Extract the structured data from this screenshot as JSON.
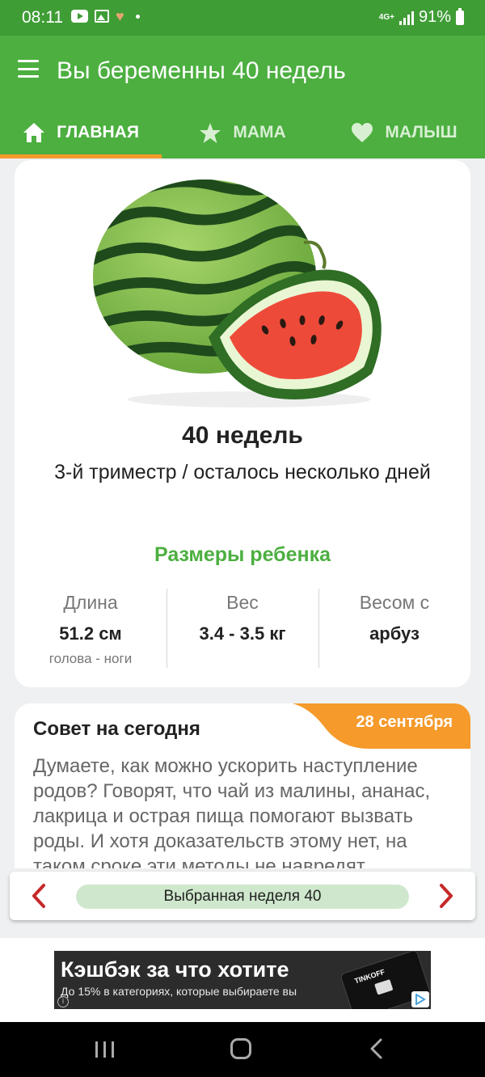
{
  "status_bar": {
    "time": "08:11",
    "network": "4G+",
    "battery": "91%"
  },
  "app_bar": {
    "title": "Вы беременны 40 недель"
  },
  "tabs": [
    {
      "label": "ГЛАВНАЯ",
      "icon": "home-icon",
      "active": true
    },
    {
      "label": "МАМА",
      "icon": "star-icon",
      "active": false
    },
    {
      "label": "МАЛЫШ",
      "icon": "heart-icon",
      "active": false
    }
  ],
  "week_card": {
    "image": "watermelon",
    "weeks_title": "40 недель",
    "trimester": "3-й триместр / осталось несколько дней",
    "sizes_title": "Размеры ребенка",
    "stats": [
      {
        "label": "Длина",
        "value": "51.2 см",
        "sub": "голова - ноги"
      },
      {
        "label": "Вес",
        "value": "3.4 - 3.5 кг",
        "sub": ""
      },
      {
        "label": "Весом с",
        "value": "арбуз",
        "sub": ""
      }
    ]
  },
  "advice": {
    "title": "Совет на сегодня",
    "date": "28 сентября",
    "text": "Думаете, как можно ускорить наступление родов? Говорят, что чай из малины, ананас, лакрица и острая пища помогают вызвать роды. И хотя доказательств этому нет, на таком сроке эти методы не навредят."
  },
  "week_selector": {
    "label": "Выбранная неделя 40"
  },
  "ad": {
    "title": "Кэшбэк за что хотите",
    "subtitle": "До 15% в категориях, которые выбираете вы",
    "card_brand": "TINKOFF"
  },
  "colors": {
    "primary_green": "#4caf40",
    "status_green": "#3f9d36",
    "accent_orange": "#f59a2b",
    "nav_red": "#c62828",
    "pill_green": "#cfe8cd"
  }
}
